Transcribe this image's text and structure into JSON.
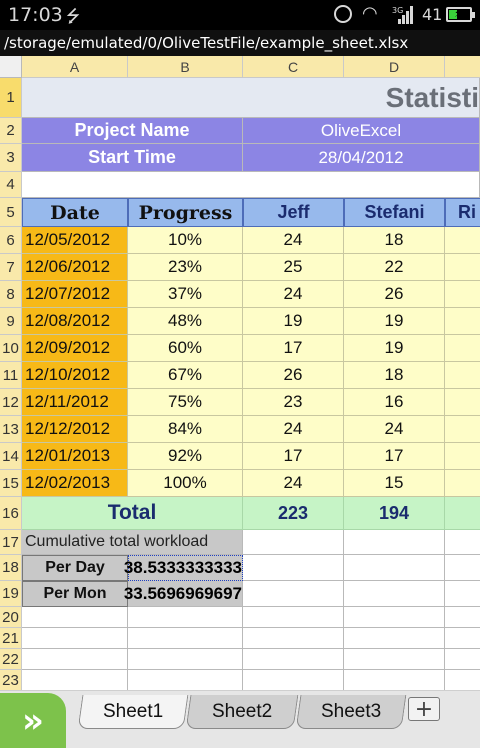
{
  "status_bar": {
    "time": "17:03",
    "network": "3G",
    "battery_percent": "41",
    "battery_level": 0.41
  },
  "path_bar": {
    "path": "/storage/emulated/0/OliveTestFile/example_sheet.xlsx"
  },
  "grid": {
    "columns": [
      "A",
      "B",
      "C",
      "D"
    ],
    "rows": [
      "1",
      "2",
      "3",
      "4",
      "5",
      "6",
      "7",
      "8",
      "9",
      "10",
      "11",
      "12",
      "13",
      "14",
      "15",
      "16",
      "17",
      "18",
      "19",
      "20",
      "21",
      "22",
      "23"
    ],
    "title": "Statisti",
    "project_name_label": "Project Name",
    "project_name_value": "OliveExcel",
    "start_time_label": "Start Time",
    "start_time_value": "28/04/2012",
    "headers": {
      "date": "Date",
      "progress": "Progress",
      "jeff": "Jeff",
      "stefani": "Stefani",
      "next": "Ri"
    },
    "data_rows": [
      {
        "date": "12/05/2012",
        "progress": "10%",
        "jeff": "24",
        "stefani": "18"
      },
      {
        "date": "12/06/2012",
        "progress": "23%",
        "jeff": "25",
        "stefani": "22"
      },
      {
        "date": "12/07/2012",
        "progress": "37%",
        "jeff": "24",
        "stefani": "26"
      },
      {
        "date": "12/08/2012",
        "progress": "48%",
        "jeff": "19",
        "stefani": "19"
      },
      {
        "date": "12/09/2012",
        "progress": "60%",
        "jeff": "17",
        "stefani": "19"
      },
      {
        "date": "12/10/2012",
        "progress": "67%",
        "jeff": "26",
        "stefani": "18"
      },
      {
        "date": "12/11/2012",
        "progress": "75%",
        "jeff": "23",
        "stefani": "16"
      },
      {
        "date": "12/12/2012",
        "progress": "84%",
        "jeff": "24",
        "stefani": "24"
      },
      {
        "date": "12/01/2013",
        "progress": "92%",
        "jeff": "17",
        "stefani": "17"
      },
      {
        "date": "12/02/2013",
        "progress": "100%",
        "jeff": "24",
        "stefani": "15"
      }
    ],
    "total_label": "Total",
    "total_jeff": "223",
    "total_stefani": "194",
    "total_next": "",
    "cumulative_label": "Cumulative total workload",
    "per_day_label": "Per Day",
    "per_day_value": "38.5333333333",
    "per_mon_label": "Per Mon",
    "per_mon_value": "33.5696969697"
  },
  "tabs": {
    "sheet1": "Sheet1",
    "sheet2": "Sheet2",
    "sheet3": "Sheet3",
    "add": "+",
    "nav": "»"
  },
  "colors": {
    "col_header_bg": "#f9e9aa",
    "date_cell_bg": "#f7b917",
    "data_cell_bg": "#fefdc8",
    "blue_header_bg": "#97b9ec",
    "purple_label_bg": "#8c85e4",
    "total_bg": "#c6f4c6",
    "gray_label_bg": "#c8c8c8",
    "nav_green": "#7dc24b"
  }
}
